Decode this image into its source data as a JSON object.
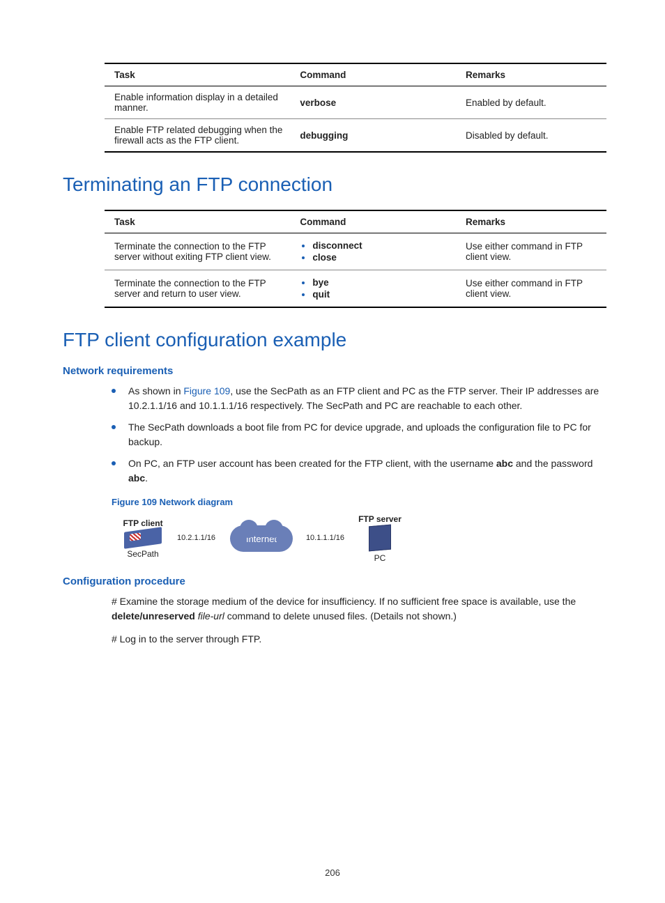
{
  "table1": {
    "headers": {
      "task": "Task",
      "command": "Command",
      "remarks": "Remarks"
    },
    "rows": [
      {
        "task": "Enable information display in a detailed manner.",
        "command": "verbose",
        "remarks": "Enabled by default."
      },
      {
        "task": "Enable FTP related debugging when the firewall acts as the FTP client.",
        "command": "debugging",
        "remarks": "Disabled by default."
      }
    ]
  },
  "section1": "Terminating an FTP connection",
  "table2": {
    "headers": {
      "task": "Task",
      "command": "Command",
      "remarks": "Remarks"
    },
    "rows": [
      {
        "task": "Terminate the connection to the FTP server without exiting FTP client view.",
        "commands": [
          "disconnect",
          "close"
        ],
        "remarks": "Use either command in FTP client view."
      },
      {
        "task": "Terminate the connection to the FTP server and return to user view.",
        "commands": [
          "bye",
          "quit"
        ],
        "remarks": "Use either command in FTP client view."
      }
    ]
  },
  "section2": "FTP client configuration example",
  "netreq": {
    "heading": "Network requirements",
    "b1a": "As shown in ",
    "b1link": "Figure 109",
    "b1b": ", use the SecPath as an FTP client and PC as the FTP server. Their IP addresses are 10.2.1.1/16 and 10.1.1.1/16 respectively. The SecPath and PC are reachable to each other.",
    "b2": "The SecPath downloads a boot file from PC for device upgrade, and uploads the configuration file to PC for backup.",
    "b3a": "On PC, an FTP user account has been created for the FTP client, with the username ",
    "b3user": "abc",
    "b3b": " and the password ",
    "b3pass": "abc",
    "b3c": "."
  },
  "figcap": "Figure 109 Network diagram",
  "diagram": {
    "client_label": "FTP client",
    "client_ip": "10.2.1.1/16",
    "client_name": "SecPath",
    "cloud": "Internet",
    "server_label": "FTP server",
    "server_ip": "10.1.1.1/16",
    "server_name": "PC"
  },
  "confproc": {
    "heading": "Configuration procedure",
    "p1a": "# Examine the storage medium of the device for insufficiency. If no sufficient free space is available, use the ",
    "p1cmd": "delete/unreserved",
    "p1sp": " ",
    "p1arg": "file-url",
    "p1b": " command to delete unused files. (Details not shown.)",
    "p2": "# Log in to the server through FTP."
  },
  "pagenum": "206"
}
